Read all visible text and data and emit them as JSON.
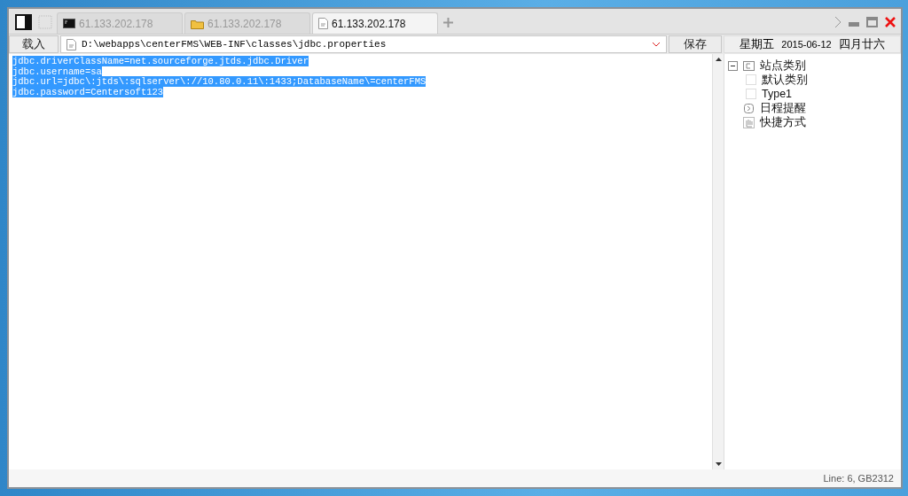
{
  "tabs": [
    {
      "label": "61.133.202.178",
      "kind": "terminal",
      "selected": false
    },
    {
      "label": "61.133.202.178",
      "kind": "folder",
      "selected": false
    },
    {
      "label": "61.133.202.178",
      "kind": "file",
      "selected": true
    }
  ],
  "toolbar": {
    "load_button": "载入",
    "path": "D:\\webapps\\centerFMS\\WEB-INF\\classes\\jdbc.properties",
    "save_button": "保存"
  },
  "date_bar": {
    "weekday": "星期五",
    "date": "2015-06-12",
    "lunar": "四月廿六"
  },
  "editor": {
    "lines": [
      {
        "text": "jdbc.driverClassName=net.sourceforge.jtds.jdbc.Driver",
        "selected": true
      },
      {
        "text": "jdbc.username=sa",
        "selected": true
      },
      {
        "text": "jdbc.url=jdbc\\:jtds\\:sqlserver\\://10.80.0.11\\:1433;DatabaseName\\=centerFMS",
        "selected": true
      },
      {
        "text": "jdbc.password=Centersoft123",
        "selected": true
      }
    ]
  },
  "sidebar": {
    "items": [
      {
        "label": "站点类别",
        "kind": "category",
        "expanded": true,
        "children": [
          {
            "label": "默认类别",
            "kind": "placeholder"
          },
          {
            "label": "Type1",
            "kind": "placeholder"
          }
        ]
      },
      {
        "label": "日程提醒",
        "kind": "schedule"
      },
      {
        "label": "快捷方式",
        "kind": "shortcut"
      }
    ]
  },
  "status_bar": {
    "text": "Line: 6, GB2312"
  }
}
